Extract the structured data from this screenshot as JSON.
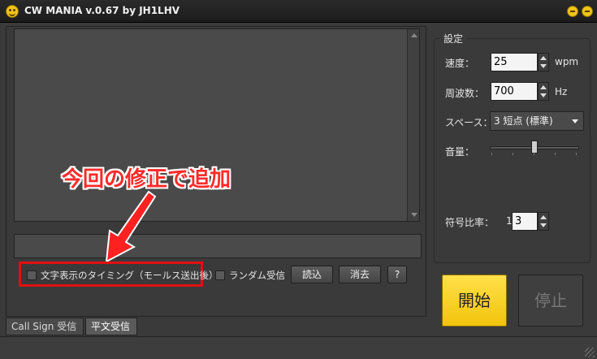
{
  "window": {
    "title": "CW MANIA v.0.67 by JH1LHV"
  },
  "options": {
    "timing_label": "文字表示のタイミング（モールス送出後）",
    "random_label": "ランダム受信"
  },
  "buttons": {
    "load": "読込",
    "clear": "消去",
    "help": "?",
    "start": "開始",
    "stop": "停止"
  },
  "annotation": {
    "text": "今回の修正で追加",
    "color": "#ff2a2a"
  },
  "tabs": [
    {
      "label": "Call Sign 受信",
      "selected": false
    },
    {
      "label": "平文受信",
      "selected": true
    }
  ],
  "settings": {
    "title": "設定",
    "speed": {
      "label": "速度：",
      "value": "25",
      "unit": "wpm"
    },
    "frequency": {
      "label": "周波数：",
      "value": "700",
      "unit": "Hz"
    },
    "space": {
      "label": "スペース：",
      "value": "3 短点 (標準)"
    },
    "volume": {
      "label": "音量：",
      "level": 0.5
    },
    "ratio": {
      "label": "符号比率：",
      "prefix": "1",
      "value": "3"
    }
  },
  "colors": {
    "accent": "#f2c40c",
    "highlight": "#e01010",
    "background": "#3a3a3a"
  },
  "icons": [
    "smiley-icon",
    "minimize-icon",
    "close-icon",
    "arrow-icon",
    "checkbox-icon"
  ]
}
